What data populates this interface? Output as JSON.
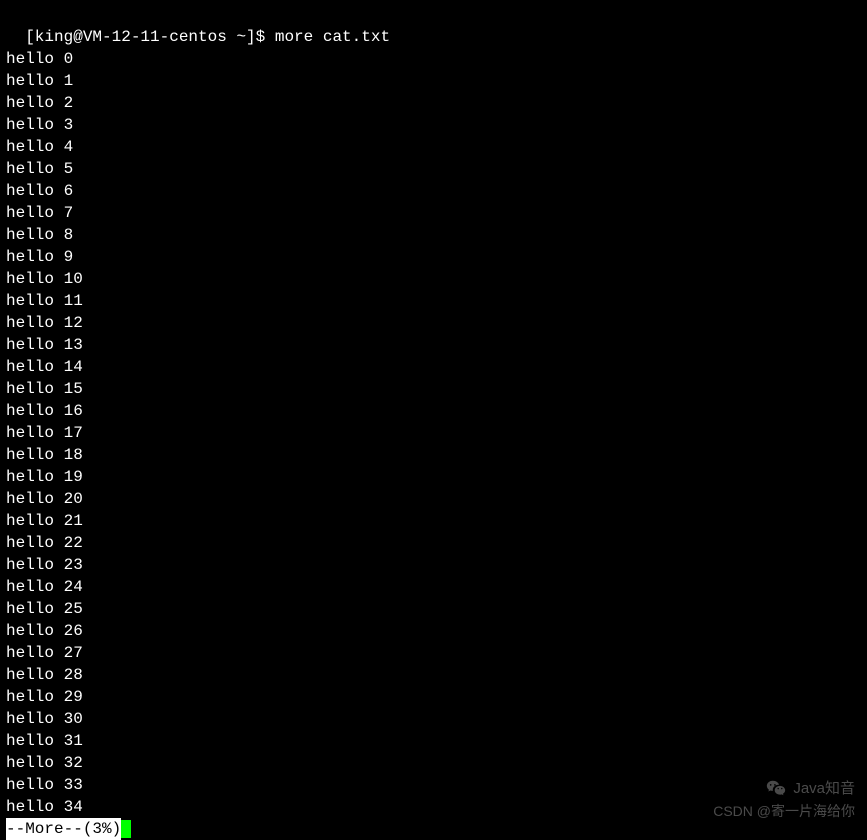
{
  "prompt": {
    "user": "king",
    "host": "VM-12-11-centos",
    "cwd": "~",
    "symbol": "$",
    "command": "more cat.txt",
    "full": "[king@VM-12-11-centos ~]$ more cat.txt"
  },
  "output": [
    "hello 0",
    "hello 1",
    "hello 2",
    "hello 3",
    "hello 4",
    "hello 5",
    "hello 6",
    "hello 7",
    "hello 8",
    "hello 9",
    "hello 10",
    "hello 11",
    "hello 12",
    "hello 13",
    "hello 14",
    "hello 15",
    "hello 16",
    "hello 17",
    "hello 18",
    "hello 19",
    "hello 20",
    "hello 21",
    "hello 22",
    "hello 23",
    "hello 24",
    "hello 25",
    "hello 26",
    "hello 27",
    "hello 28",
    "hello 29",
    "hello 30",
    "hello 31",
    "hello 32",
    "hello 33",
    "hello 34"
  ],
  "more_status": "--More--(3%)",
  "watermark": {
    "top": "Java知音",
    "bottom": "CSDN @寄一片海给你"
  }
}
